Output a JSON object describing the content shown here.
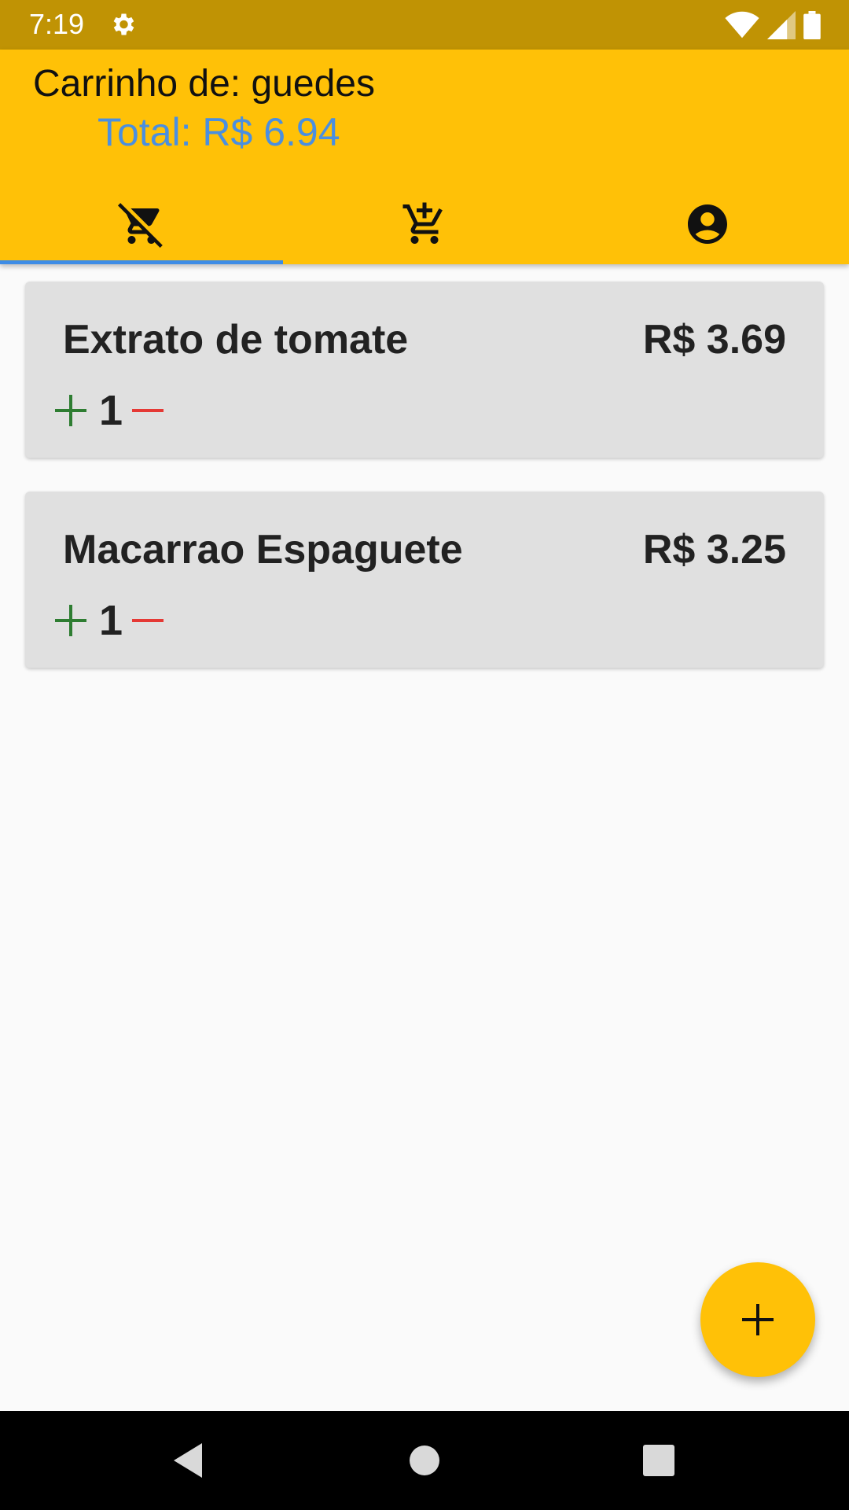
{
  "status_bar": {
    "time": "7:19"
  },
  "header": {
    "title": "Carrinho de: guedes",
    "total": "Total: R$ 6.94"
  },
  "tabs": [
    {
      "icon": "remove-shopping-cart-icon",
      "selected": true
    },
    {
      "icon": "add-shopping-cart-icon",
      "selected": false
    },
    {
      "icon": "account-circle-icon",
      "selected": false
    }
  ],
  "cart_items": [
    {
      "name": "Extrato de tomate",
      "price": "R$ 3.69",
      "quantity": "1"
    },
    {
      "name": "Macarrao Espaguete",
      "price": "R$ 3.25",
      "quantity": "1"
    }
  ],
  "colors": {
    "accent": "#ffc107",
    "status_bar": "#c09304",
    "total_text": "#4a8fe0",
    "plus": "#2e7d32",
    "minus": "#e53935",
    "tab_indicator": "#3d8ce6"
  }
}
